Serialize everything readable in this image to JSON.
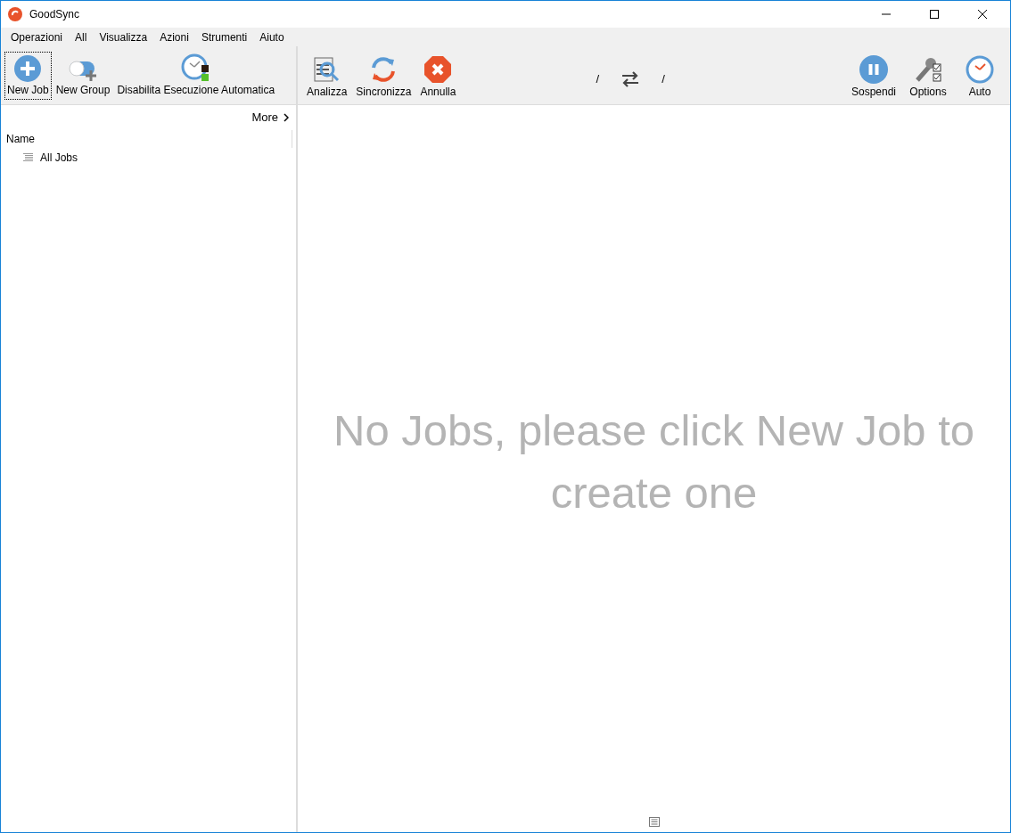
{
  "window": {
    "title": "GoodSync"
  },
  "menu": [
    "Operazioni",
    "All",
    "Visualizza",
    "Azioni",
    "Strumenti",
    "Aiuto"
  ],
  "left_toolbar": [
    {
      "kind": "new-job",
      "label": "New Job",
      "focused": true
    },
    {
      "kind": "new-group",
      "label": "New Group",
      "focused": false
    },
    {
      "kind": "auto-clock",
      "label": "Disabilita Esecuzione Automatica",
      "focused": false
    }
  ],
  "job_toolbar": [
    {
      "kind": "analyze",
      "label": "Analizza"
    },
    {
      "kind": "sync",
      "label": "Sincronizza"
    },
    {
      "kind": "cancel",
      "label": "Annulla"
    }
  ],
  "paths": {
    "left": "/",
    "right": "/"
  },
  "right_toolbar": [
    {
      "kind": "pause",
      "label": "Sospendi"
    },
    {
      "kind": "options",
      "label": "Options"
    },
    {
      "kind": "clock",
      "label": "Auto"
    }
  ],
  "sidebar": {
    "more": "More",
    "column": "Name",
    "tree": [
      {
        "label": "All Jobs"
      }
    ]
  },
  "main": {
    "message": "No Jobs, please click New Job to create one"
  }
}
